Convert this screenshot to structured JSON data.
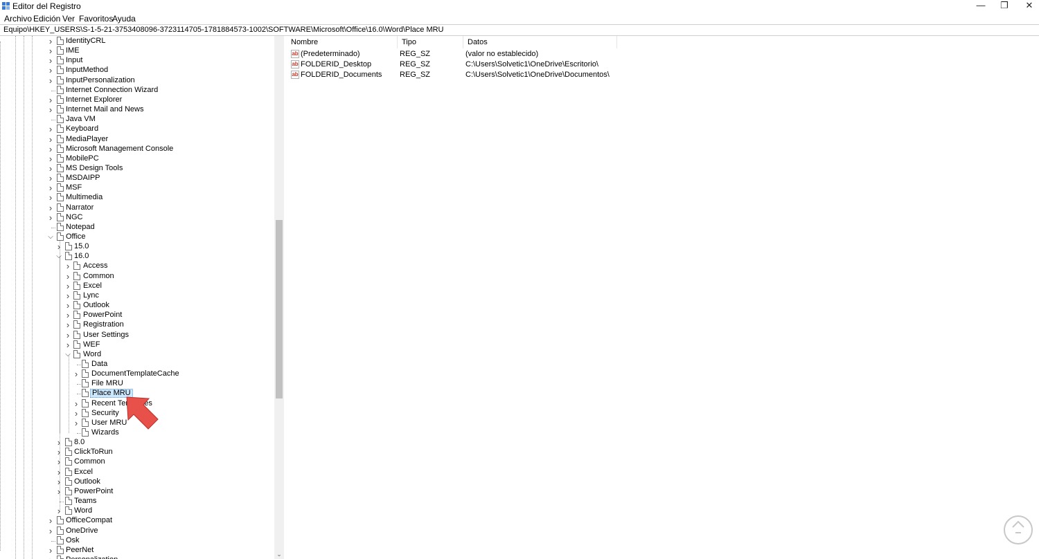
{
  "window": {
    "title": "Editor del Registro",
    "min": "—",
    "max": "❐",
    "close": "✕"
  },
  "menu": [
    "Archivo",
    "Edición",
    "Ver",
    "Favoritos",
    "Ayuda"
  ],
  "address": "Equipo\\HKEY_USERS\\S-1-5-21-3753408096-3723114705-1781884573-1002\\SOFTWARE\\Microsoft\\Office\\16.0\\Word\\Place MRU",
  "tree": [
    {
      "label": "IdentityCRL",
      "depth": 0,
      "expander": "collapsed"
    },
    {
      "label": "IME",
      "depth": 0,
      "expander": "collapsed"
    },
    {
      "label": "Input",
      "depth": 0,
      "expander": "collapsed"
    },
    {
      "label": "InputMethod",
      "depth": 0,
      "expander": "collapsed"
    },
    {
      "label": "InputPersonalization",
      "depth": 0,
      "expander": "collapsed"
    },
    {
      "label": "Internet Connection Wizard",
      "depth": 0,
      "expander": "none"
    },
    {
      "label": "Internet Explorer",
      "depth": 0,
      "expander": "collapsed"
    },
    {
      "label": "Internet Mail and News",
      "depth": 0,
      "expander": "collapsed"
    },
    {
      "label": "Java VM",
      "depth": 0,
      "expander": "none"
    },
    {
      "label": "Keyboard",
      "depth": 0,
      "expander": "collapsed"
    },
    {
      "label": "MediaPlayer",
      "depth": 0,
      "expander": "collapsed"
    },
    {
      "label": "Microsoft Management Console",
      "depth": 0,
      "expander": "collapsed"
    },
    {
      "label": "MobilePC",
      "depth": 0,
      "expander": "collapsed"
    },
    {
      "label": "MS Design Tools",
      "depth": 0,
      "expander": "collapsed"
    },
    {
      "label": "MSDAIPP",
      "depth": 0,
      "expander": "collapsed"
    },
    {
      "label": "MSF",
      "depth": 0,
      "expander": "collapsed"
    },
    {
      "label": "Multimedia",
      "depth": 0,
      "expander": "collapsed"
    },
    {
      "label": "Narrator",
      "depth": 0,
      "expander": "collapsed"
    },
    {
      "label": "NGC",
      "depth": 0,
      "expander": "collapsed"
    },
    {
      "label": "Notepad",
      "depth": 0,
      "expander": "none"
    },
    {
      "label": "Office",
      "depth": 0,
      "expander": "expanded"
    },
    {
      "label": "15.0",
      "depth": 1,
      "expander": "collapsed"
    },
    {
      "label": "16.0",
      "depth": 1,
      "expander": "expanded"
    },
    {
      "label": "Access",
      "depth": 2,
      "expander": "collapsed"
    },
    {
      "label": "Common",
      "depth": 2,
      "expander": "collapsed"
    },
    {
      "label": "Excel",
      "depth": 2,
      "expander": "collapsed"
    },
    {
      "label": "Lync",
      "depth": 2,
      "expander": "collapsed"
    },
    {
      "label": "Outlook",
      "depth": 2,
      "expander": "collapsed"
    },
    {
      "label": "PowerPoint",
      "depth": 2,
      "expander": "collapsed"
    },
    {
      "label": "Registration",
      "depth": 2,
      "expander": "collapsed"
    },
    {
      "label": "User Settings",
      "depth": 2,
      "expander": "collapsed"
    },
    {
      "label": "WEF",
      "depth": 2,
      "expander": "collapsed"
    },
    {
      "label": "Word",
      "depth": 2,
      "expander": "expanded"
    },
    {
      "label": "Data",
      "depth": 3,
      "expander": "none"
    },
    {
      "label": "DocumentTemplateCache",
      "depth": 3,
      "expander": "collapsed"
    },
    {
      "label": "File MRU",
      "depth": 3,
      "expander": "none"
    },
    {
      "label": "Place MRU",
      "depth": 3,
      "expander": "none",
      "selected": true
    },
    {
      "label": "Recent Templates",
      "depth": 3,
      "expander": "collapsed"
    },
    {
      "label": "Security",
      "depth": 3,
      "expander": "collapsed"
    },
    {
      "label": "User MRU",
      "depth": 3,
      "expander": "collapsed"
    },
    {
      "label": "Wizards",
      "depth": 3,
      "expander": "none"
    },
    {
      "label": "8.0",
      "depth": 1,
      "expander": "collapsed"
    },
    {
      "label": "ClickToRun",
      "depth": 1,
      "expander": "collapsed"
    },
    {
      "label": "Common",
      "depth": 1,
      "expander": "collapsed"
    },
    {
      "label": "Excel",
      "depth": 1,
      "expander": "collapsed"
    },
    {
      "label": "Outlook",
      "depth": 1,
      "expander": "collapsed"
    },
    {
      "label": "PowerPoint",
      "depth": 1,
      "expander": "collapsed"
    },
    {
      "label": "Teams",
      "depth": 1,
      "expander": "none"
    },
    {
      "label": "Word",
      "depth": 1,
      "expander": "collapsed"
    },
    {
      "label": "OfficeCompat",
      "depth": 0,
      "expander": "collapsed"
    },
    {
      "label": "OneDrive",
      "depth": 0,
      "expander": "collapsed"
    },
    {
      "label": "Osk",
      "depth": 0,
      "expander": "none"
    },
    {
      "label": "PeerNet",
      "depth": 0,
      "expander": "collapsed"
    },
    {
      "label": "Personalization",
      "depth": 0,
      "expander": "collapsed"
    }
  ],
  "columns": [
    "Nombre",
    "Tipo",
    "Datos"
  ],
  "values": [
    {
      "icon": "ab",
      "name": "(Predeterminado)",
      "type": "REG_SZ",
      "data": "(valor no establecido)"
    },
    {
      "icon": "ab",
      "name": "FOLDERID_Desktop",
      "type": "REG_SZ",
      "data": "C:\\Users\\Solvetic1\\OneDrive\\Escritorio\\"
    },
    {
      "icon": "ab",
      "name": "FOLDERID_Documents",
      "type": "REG_SZ",
      "data": "C:\\Users\\Solvetic1\\OneDrive\\Documentos\\"
    }
  ],
  "colors": {
    "selection": "#cce8ff",
    "arrow": "#e8504a"
  }
}
